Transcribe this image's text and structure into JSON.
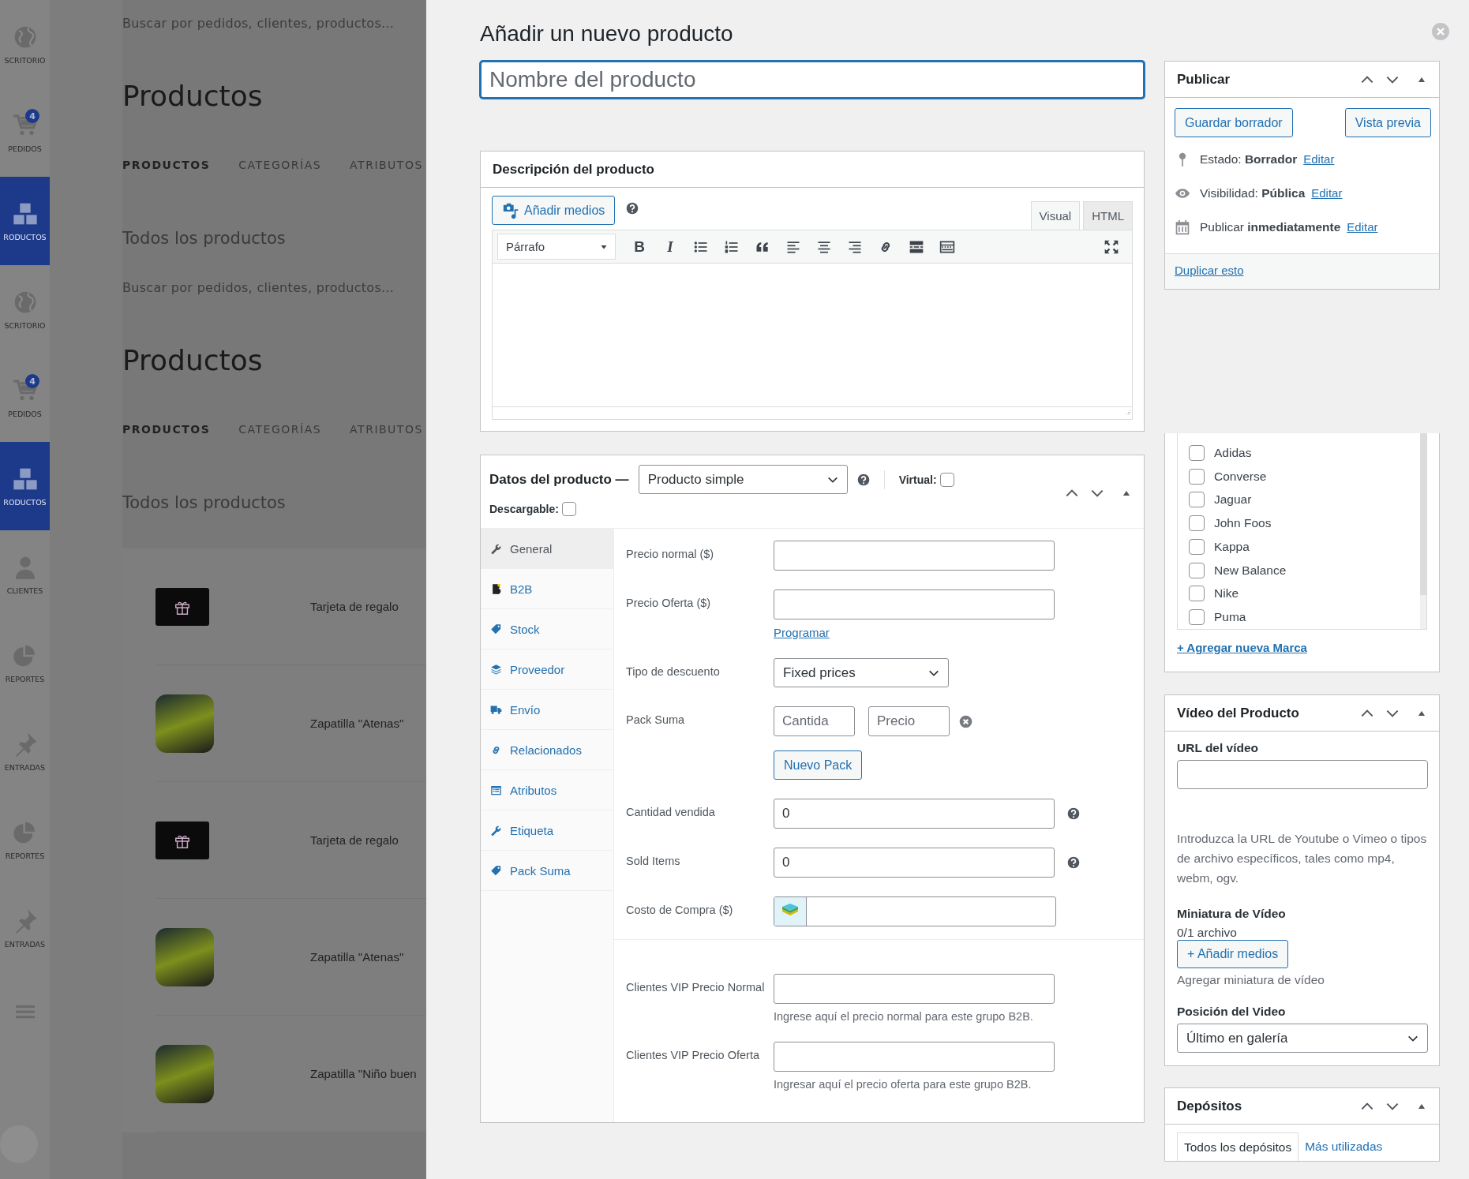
{
  "background": {
    "sidebar": [
      {
        "kind": "globe",
        "label": "SCRITORIO",
        "selected": false
      },
      {
        "kind": "cart",
        "label": "PEDIDOS",
        "badge": "4",
        "selected": false
      },
      {
        "kind": "boxes",
        "label": "RODUCTOS",
        "selected": true
      },
      {
        "kind": "globe",
        "label": "SCRITORIO",
        "selected": false
      },
      {
        "kind": "cart",
        "label": "PEDIDOS",
        "badge": "4",
        "selected": false
      },
      {
        "kind": "boxes",
        "label": "RODUCTOS",
        "selected": true
      },
      {
        "kind": "person",
        "label": "CLIENTES",
        "selected": false
      },
      {
        "kind": "pie",
        "label": "REPORTES",
        "selected": false
      },
      {
        "kind": "pin",
        "label": "ENTRADAS",
        "selected": false
      },
      {
        "kind": "pie",
        "label": "REPORTES",
        "selected": false
      },
      {
        "kind": "pin",
        "label": "ENTRADAS",
        "selected": false
      },
      {
        "kind": "menu",
        "selected": false
      },
      {
        "kind": "avatar",
        "selected": false
      }
    ],
    "sections": [
      {
        "search_placeholder": "Buscar por pedidos, clientes, productos...",
        "title": "Productos",
        "tabs": [
          {
            "label": "PRODUCTOS",
            "selected": true
          },
          {
            "label": "CATEGORÍAS",
            "selected": false
          },
          {
            "label": "ATRIBUTOS",
            "selected": false
          }
        ],
        "subtitle": "Todos los productos"
      },
      {
        "search_placeholder": "Buscar por pedidos, clientes, productos...",
        "title": "Productos",
        "tabs": [
          {
            "label": "PRODUCTOS",
            "selected": true
          },
          {
            "label": "CATEGORÍAS",
            "selected": false
          },
          {
            "label": "ATRIBUTOS",
            "selected": false
          }
        ],
        "subtitle": "Todos los productos"
      }
    ],
    "products": [
      {
        "name": "Tarjeta de regalo",
        "kind": "gift"
      },
      {
        "name": "Zapatilla \"Atenas\"",
        "kind": "photo"
      },
      {
        "name": "Tarjeta de regalo",
        "kind": "gift"
      },
      {
        "name": "Zapatilla \"Atenas\"",
        "kind": "photo"
      },
      {
        "name": "Zapatilla \"Niño buen",
        "kind": "photo"
      }
    ]
  },
  "modal": {
    "title": "Añadir un nuevo producto",
    "name_placeholder": "Nombre del producto",
    "description": {
      "title": "Descripción del producto",
      "add_media": "Añadir medios",
      "tabs": [
        {
          "label": "Visual",
          "selected": true
        },
        {
          "label": "HTML",
          "selected": false
        }
      ],
      "format": "Párrafo",
      "toolbar": [
        {
          "kind": "bold",
          "text": "B"
        },
        {
          "kind": "italic",
          "text": "I"
        },
        {
          "kind": "bullet-list"
        },
        {
          "kind": "numbered-list"
        },
        {
          "kind": "quote"
        },
        {
          "kind": "align-left"
        },
        {
          "kind": "align-center"
        },
        {
          "kind": "align-right"
        },
        {
          "kind": "link"
        },
        {
          "kind": "read-more"
        },
        {
          "kind": "toolbar-toggle"
        }
      ]
    },
    "product_data": {
      "title": "Datos del producto —",
      "type": "Producto simple",
      "virtual_label": "Virtual:",
      "virtual_checked": false,
      "downloadable_label": "Descargable:",
      "downloadable_checked": false,
      "tabs": [
        {
          "label": "General",
          "kind": "wrench",
          "selected": true
        },
        {
          "label": "B2B",
          "kind": "badge",
          "selected": false
        },
        {
          "label": "Stock",
          "kind": "tag",
          "selected": false
        },
        {
          "label": "Proveedor",
          "kind": "layers",
          "selected": false
        },
        {
          "label": "Envío",
          "kind": "truck",
          "selected": false
        },
        {
          "label": "Relacionados",
          "kind": "link",
          "selected": false
        },
        {
          "label": "Atributos",
          "kind": "list",
          "selected": false
        },
        {
          "label": "Etiqueta",
          "kind": "wrench",
          "selected": false
        },
        {
          "label": "Pack Suma",
          "kind": "tag",
          "selected": false
        }
      ],
      "fields": [
        {
          "kind": "text",
          "label": "Precio normal ($)"
        },
        {
          "kind": "text",
          "label": "Precio Oferta ($)",
          "link": "Programar"
        },
        {
          "kind": "select",
          "label": "Tipo de descuento",
          "value": "Fixed prices"
        },
        {
          "kind": "pack",
          "label": "Pack Suma",
          "inputs": [
            {
              "placeholder": "Cantida"
            },
            {
              "placeholder": "Precio"
            }
          ],
          "button": "Nuevo Pack"
        },
        {
          "kind": "text",
          "label": "Cantidad vendida",
          "value": "0",
          "help": true
        },
        {
          "kind": "text",
          "label": "Sold Items",
          "value": "0",
          "help": true
        },
        {
          "kind": "addon",
          "label": "Costo de Compra ($)"
        },
        {
          "kind": "divider"
        },
        {
          "kind": "text",
          "label": "Clientes VIP Precio Normal",
          "hint": "Ingrese aquí el precio normal para este grupo B2B."
        },
        {
          "kind": "text",
          "label": "Clientes VIP Precio Oferta",
          "hint": "Ingresar aquí el precio oferta para este grupo B2B."
        }
      ]
    },
    "publish": {
      "title": "Publicar",
      "save_draft": "Guardar borrador",
      "preview": "Vista previa",
      "rows": [
        {
          "kind": "pin",
          "text": "Estado: **Borrador**",
          "link": "Editar"
        },
        {
          "kind": "eye",
          "text": "Visibilidad: **Pública**",
          "link": "Editar"
        },
        {
          "kind": "calendar",
          "text": "Publicar **inmediatamente**",
          "link": "Editar"
        }
      ],
      "duplicate": "Duplicar esto"
    },
    "brands": {
      "items": [
        {
          "label": "Adidas",
          "checked": false
        },
        {
          "label": "Converse",
          "checked": false
        },
        {
          "label": "Jaguar",
          "checked": false
        },
        {
          "label": "John Foos",
          "checked": false
        },
        {
          "label": "Kappa",
          "checked": false
        },
        {
          "label": "New Balance",
          "checked": false
        },
        {
          "label": "Nike",
          "checked": false
        },
        {
          "label": "Puma",
          "checked": false
        }
      ],
      "add_link": "+ Agregar nueva Marca"
    },
    "video": {
      "title": "Vídeo del Producto",
      "url_label": "URL del vídeo",
      "help": "Introduzca la URL de Youtube o Vimeo o tipos de archivo específicos, tales como mp4, webm, ogv.",
      "thumb_label": "Miniatura de Vídeo",
      "thumb_count": "0/1 archivo",
      "add_media": "+ Añadir medios",
      "thumb_hint": "Agregar miniatura de vídeo",
      "position_label": "Posición del Video",
      "position": "Último en galería"
    },
    "deposits": {
      "title": "Depósitos",
      "tabs": [
        {
          "label": "Todos los depósitos",
          "selected": true
        },
        {
          "label": "Más utilizadas",
          "selected": false
        }
      ]
    }
  }
}
